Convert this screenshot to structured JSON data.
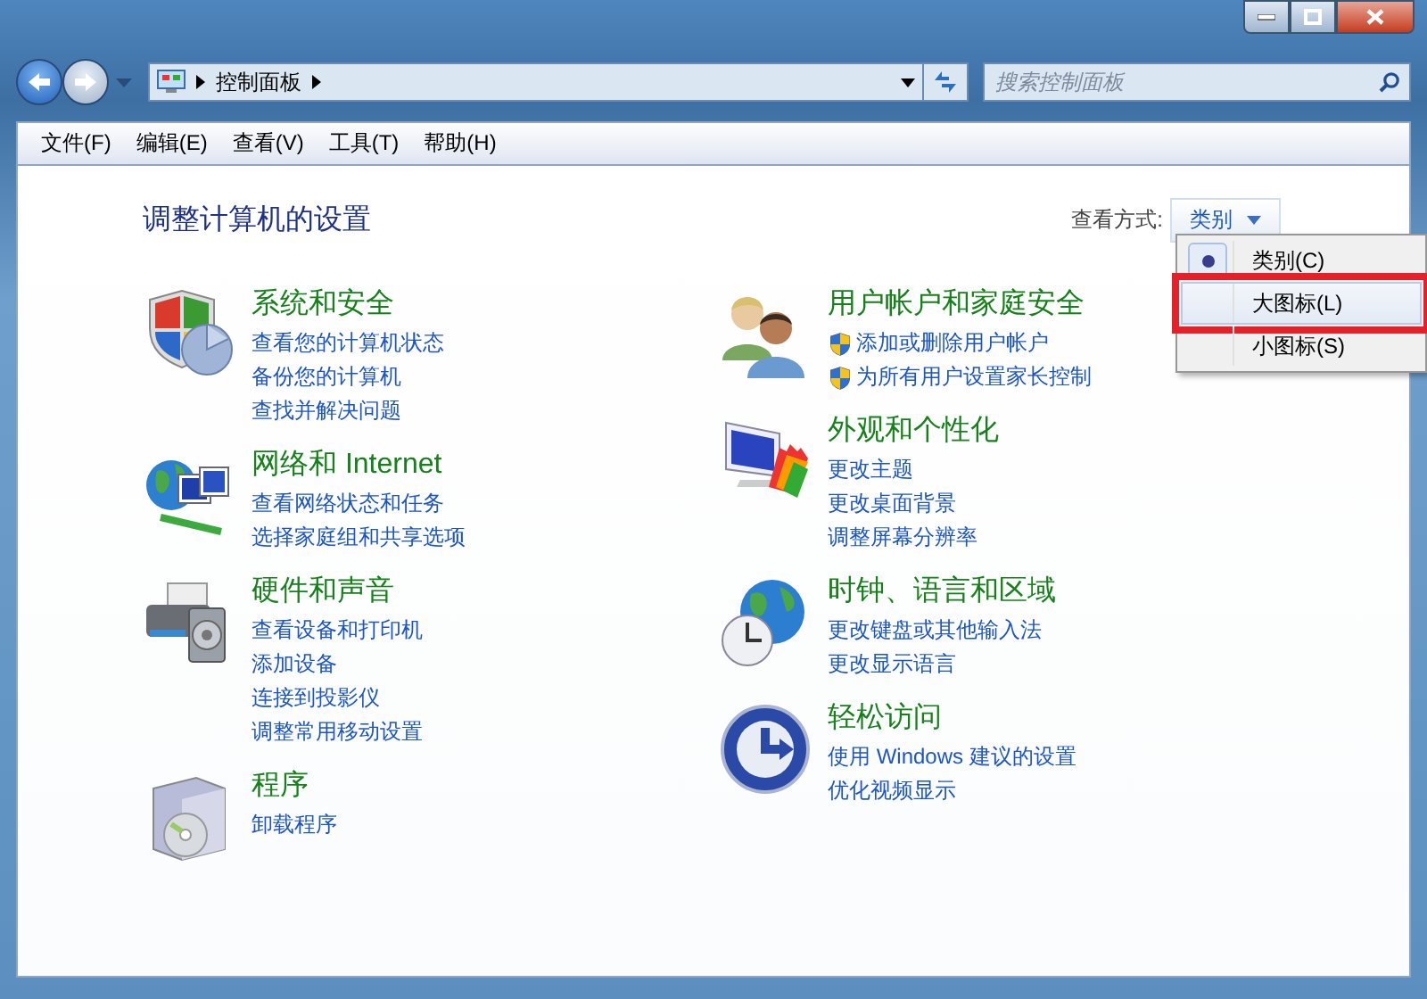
{
  "address": {
    "crumbs": [
      "控制面板"
    ]
  },
  "search": {
    "placeholder": "搜索控制面板"
  },
  "menu_bar": [
    "文件(F)",
    "编辑(E)",
    "查看(V)",
    "工具(T)",
    "帮助(H)"
  ],
  "heading": "调整计算机的设置",
  "view_by": {
    "label": "查看方式:",
    "value": "类别",
    "expanded": true,
    "options": [
      {
        "label": "类别(C)",
        "checked": true,
        "hovered": false
      },
      {
        "label": "大图标(L)",
        "checked": false,
        "hovered": true
      },
      {
        "label": "小图标(S)",
        "checked": false,
        "hovered": false
      }
    ]
  },
  "columns": [
    [
      {
        "title": "系统和安全",
        "links": [
          {
            "text": "查看您的计算机状态",
            "kind": "plain"
          },
          {
            "text": "备份您的计算机",
            "kind": "plain"
          },
          {
            "text": "查找并解决问题",
            "kind": "plain"
          }
        ]
      },
      {
        "title": "网络和 Internet",
        "links": [
          {
            "text": "查看网络状态和任务",
            "kind": "plain"
          },
          {
            "text": "选择家庭组和共享选项",
            "kind": "plain"
          }
        ]
      },
      {
        "title": "硬件和声音",
        "links": [
          {
            "text": "查看设备和打印机",
            "kind": "plain"
          },
          {
            "text": "添加设备",
            "kind": "plain"
          },
          {
            "text": "连接到投影仪",
            "kind": "plain"
          },
          {
            "text": "调整常用移动设置",
            "kind": "plain"
          }
        ]
      },
      {
        "title": "程序",
        "links": [
          {
            "text": "卸载程序",
            "kind": "plain"
          }
        ]
      }
    ],
    [
      {
        "title": "用户帐户和家庭安全",
        "links": [
          {
            "text": "添加或删除用户帐户",
            "kind": "shield"
          },
          {
            "text": "为所有用户设置家长控制",
            "kind": "shield"
          }
        ]
      },
      {
        "title": "外观和个性化",
        "links": [
          {
            "text": "更改主题",
            "kind": "plain"
          },
          {
            "text": "更改桌面背景",
            "kind": "plain"
          },
          {
            "text": "调整屏幕分辨率",
            "kind": "plain"
          }
        ]
      },
      {
        "title": "时钟、语言和区域",
        "links": [
          {
            "text": "更改键盘或其他输入法",
            "kind": "plain"
          },
          {
            "text": "更改显示语言",
            "kind": "plain"
          }
        ]
      },
      {
        "title": "轻松访问",
        "links": [
          {
            "text": "使用 Windows 建议的设置",
            "kind": "plain"
          },
          {
            "text": "优化视频显示",
            "kind": "plain"
          }
        ]
      }
    ]
  ]
}
